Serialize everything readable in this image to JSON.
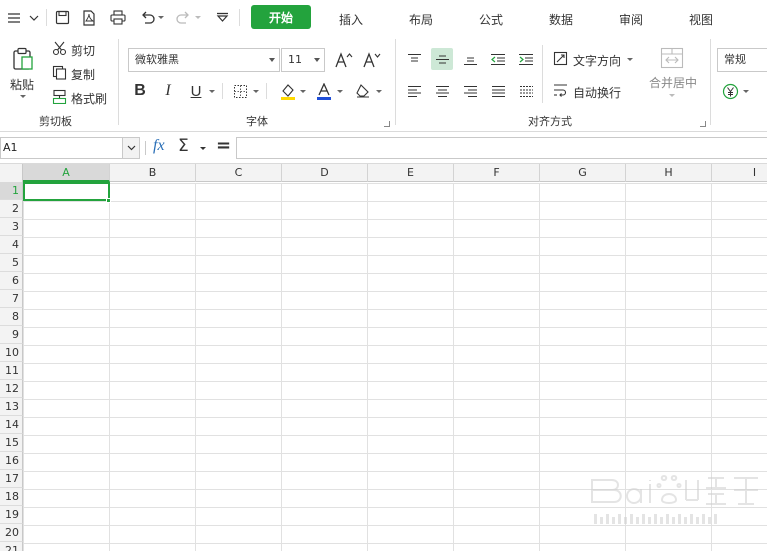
{
  "menubar": {
    "tabs": [
      "开始",
      "插入",
      "布局",
      "公式",
      "数据",
      "审阅",
      "视图"
    ],
    "active_tab": "开始"
  },
  "ribbon": {
    "clipboard": {
      "paste": "粘贴",
      "cut": "剪切",
      "copy": "复制",
      "format_painter": "格式刷",
      "group_label": "剪切板"
    },
    "font": {
      "font_name": "微软雅黑",
      "font_size": "11",
      "bold": "B",
      "italic": "I",
      "underline": "U",
      "group_label": "字体"
    },
    "alignment": {
      "text_direction": "文字方向",
      "wrap_text": "自动换行",
      "merge_center": "合并居中",
      "group_label": "对齐方式"
    },
    "number": {
      "format": "常规"
    }
  },
  "formulabar": {
    "name_box": "A1",
    "fx_symbol": "fx",
    "sum_symbol": "Σ",
    "equals_symbol": "="
  },
  "grid": {
    "columns": [
      "A",
      "B",
      "C",
      "D",
      "E",
      "F",
      "G",
      "H",
      "I"
    ],
    "rows": [
      "1",
      "2",
      "3",
      "4",
      "5",
      "6",
      "7",
      "8",
      "9",
      "10",
      "11",
      "12",
      "13",
      "14",
      "15",
      "16",
      "17",
      "18",
      "19",
      "20",
      "21"
    ],
    "selected_cell": "A1"
  },
  "colors": {
    "accent_green": "#23a33d",
    "header_bg": "#f3f3f3",
    "gridline": "#e1e1e1"
  },
  "icons": [
    "menu-icon",
    "save-icon",
    "pdf-icon",
    "print-icon",
    "undo-icon",
    "redo-icon",
    "customize-icon",
    "paste-icon",
    "cut-icon",
    "copy-icon",
    "format-painter-icon",
    "increase-font-icon",
    "decrease-font-icon",
    "border-icon",
    "fill-color-icon",
    "font-color-icon",
    "clear-icon",
    "align-top-icon",
    "align-middle-icon",
    "align-bottom-icon",
    "decrease-indent-icon",
    "increase-indent-icon",
    "align-left-icon",
    "align-center-icon",
    "align-right-icon",
    "justify-icon",
    "distributed-icon",
    "text-direction-icon",
    "wrap-text-icon",
    "merge-center-icon",
    "currency-icon"
  ]
}
